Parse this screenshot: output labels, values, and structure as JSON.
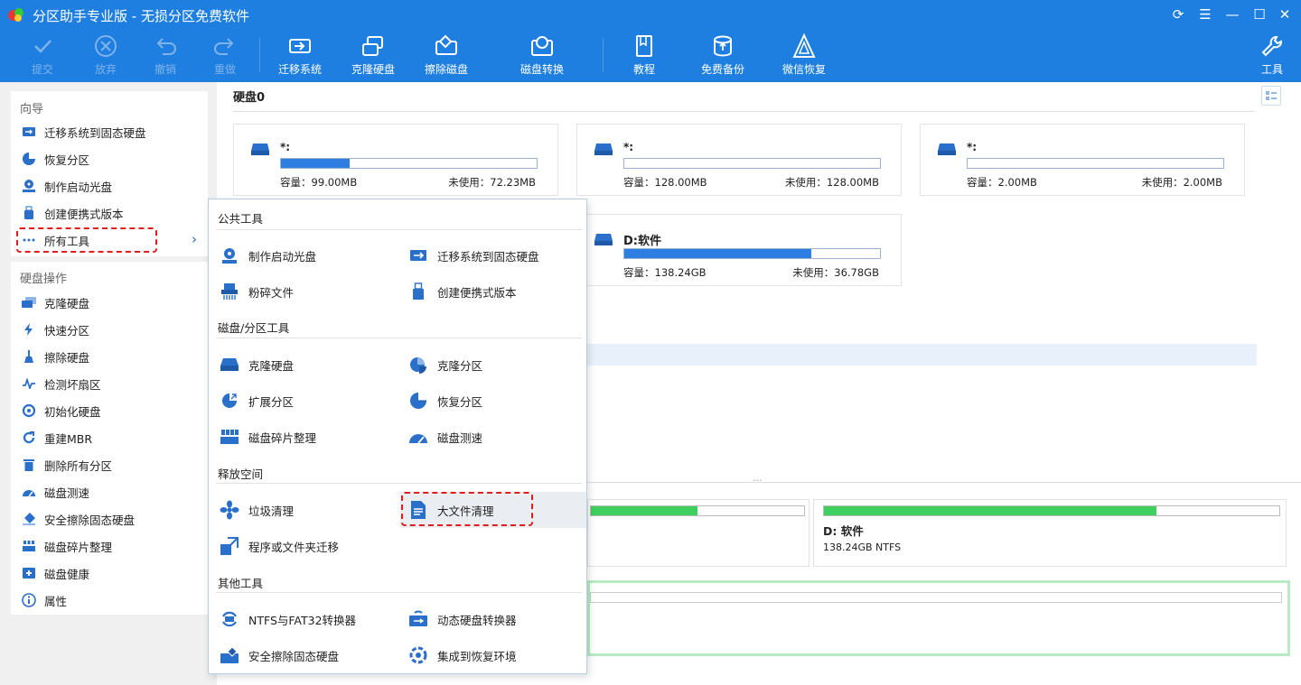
{
  "window": {
    "title": "分区助手专业版 - 无损分区免费软件",
    "controls": [
      "⟳",
      "☰",
      "—",
      "☐",
      "✕"
    ]
  },
  "toolbar": {
    "items": [
      {
        "label": "提交",
        "icon": "check-icon",
        "enabled": false
      },
      {
        "label": "放弃",
        "icon": "cancel-circle-icon",
        "enabled": false
      },
      {
        "label": "撤销",
        "icon": "undo-icon",
        "enabled": false
      },
      {
        "label": "重做",
        "icon": "redo-icon",
        "enabled": false
      },
      {
        "label": "迁移系统",
        "icon": "migrate-disk-icon",
        "enabled": true
      },
      {
        "label": "克隆硬盘",
        "icon": "clone-disk-icon",
        "enabled": true
      },
      {
        "label": "擦除磁盘",
        "icon": "wipe-disk-icon",
        "enabled": true
      },
      {
        "label": "磁盘转换",
        "icon": "convert-disk-icon",
        "enabled": true
      },
      {
        "label": "教程",
        "icon": "book-icon",
        "enabled": true
      },
      {
        "label": "免费备份",
        "icon": "backup-icon",
        "enabled": true
      },
      {
        "label": "微信恢复",
        "icon": "recovery-logo-icon",
        "enabled": true
      },
      {
        "label": "工具",
        "icon": "wrench-icon",
        "enabled": true
      }
    ]
  },
  "sidebar": {
    "wizard_title": "向导",
    "wizard_items": [
      {
        "label": "迁移系统到固态硬盘",
        "icon": "migrate-icon"
      },
      {
        "label": "恢复分区",
        "icon": "pie-recover-icon"
      },
      {
        "label": "制作启动光盘",
        "icon": "boot-disc-icon"
      },
      {
        "label": "创建便携式版本",
        "icon": "usb-icon"
      },
      {
        "label": "所有工具",
        "icon": "more-dots-icon",
        "chevron": "›"
      }
    ],
    "disk_ops_title": "硬盘操作",
    "disk_ops_items": [
      {
        "label": "克隆硬盘",
        "icon": "clone-disk-icon"
      },
      {
        "label": "快速分区",
        "icon": "lightning-icon"
      },
      {
        "label": "擦除硬盘",
        "icon": "broom-icon"
      },
      {
        "label": "检测坏扇区",
        "icon": "pulse-icon"
      },
      {
        "label": "初始化硬盘",
        "icon": "init-icon"
      },
      {
        "label": "重建MBR",
        "icon": "rebuild-icon"
      },
      {
        "label": "删除所有分区",
        "icon": "trash-icon"
      },
      {
        "label": "磁盘测速",
        "icon": "speedometer-icon"
      },
      {
        "label": "安全擦除固态硬盘",
        "icon": "eraser-icon"
      },
      {
        "label": "磁盘碎片整理",
        "icon": "defrag-icon"
      },
      {
        "label": "磁盘健康",
        "icon": "health-icon"
      },
      {
        "label": "属性",
        "icon": "info-icon"
      }
    ]
  },
  "main": {
    "disk_title": "硬盘0",
    "partitions": [
      {
        "name": "*:",
        "capacity_label": "容量：99.00MB",
        "unused_label": "未使用：72.23MB",
        "used_fraction": 0.27
      },
      {
        "name": "*:",
        "capacity_label": "容量：128.00MB",
        "unused_label": "未使用：128.00MB",
        "used_fraction": 0.0
      },
      {
        "name": "*:",
        "capacity_label": "容量：2.00MB",
        "unused_label": "未使用：2.00MB",
        "used_fraction": 0.0
      },
      {
        "name": "D:软件",
        "capacity_label": "容量：138.24GB",
        "unused_label": "未使用：36.78GB",
        "used_fraction": 0.73
      }
    ],
    "map": {
      "d_name": "D: 软件",
      "d_info": "138.24GB NTFS",
      "d_used_fraction": 0.73,
      "left_used_fraction": 0.5
    },
    "splitter_grip": "···"
  },
  "all_tools": {
    "groups": [
      {
        "title": "公共工具",
        "items": [
          {
            "label": "制作启动光盘",
            "icon": "boot-disc-icon"
          },
          {
            "label": "迁移系统到固态硬盘",
            "icon": "migrate-icon"
          },
          {
            "label": "粉碎文件",
            "icon": "shredder-icon"
          },
          {
            "label": "创建便携式版本",
            "icon": "usb-icon"
          }
        ]
      },
      {
        "title": "磁盘/分区工具",
        "items": [
          {
            "label": "克隆硬盘",
            "icon": "clone-disk-icon"
          },
          {
            "label": "克隆分区",
            "icon": "clone-partition-icon"
          },
          {
            "label": "扩展分区",
            "icon": "extend-partition-icon"
          },
          {
            "label": "恢复分区",
            "icon": "pie-recover-icon"
          },
          {
            "label": "磁盘碎片整理",
            "icon": "defrag-icon"
          },
          {
            "label": "磁盘测速",
            "icon": "speedometer-icon"
          }
        ]
      },
      {
        "title": "释放空间",
        "items": [
          {
            "label": "垃圾清理",
            "icon": "fan-clean-icon"
          },
          {
            "label": "大文件清理",
            "icon": "document-icon"
          },
          {
            "label": "程序或文件夹迁移",
            "icon": "app-move-icon"
          }
        ]
      },
      {
        "title": "其他工具",
        "items": [
          {
            "label": "NTFS与FAT32转换器",
            "icon": "convert-fs-icon"
          },
          {
            "label": "动态硬盘转换器",
            "icon": "dynamic-disk-icon"
          },
          {
            "label": "安全擦除固态硬盘",
            "icon": "eraser-icon"
          },
          {
            "label": "集成到恢复环境",
            "icon": "gear-recovery-icon"
          }
        ]
      }
    ]
  },
  "colors": {
    "accent": "#1f7fe0",
    "icon_blue": "#2a6fc9",
    "highlight_box": "#e21b1b",
    "partition_used": "#2e7de0",
    "map_used": "#3fcf5f"
  }
}
